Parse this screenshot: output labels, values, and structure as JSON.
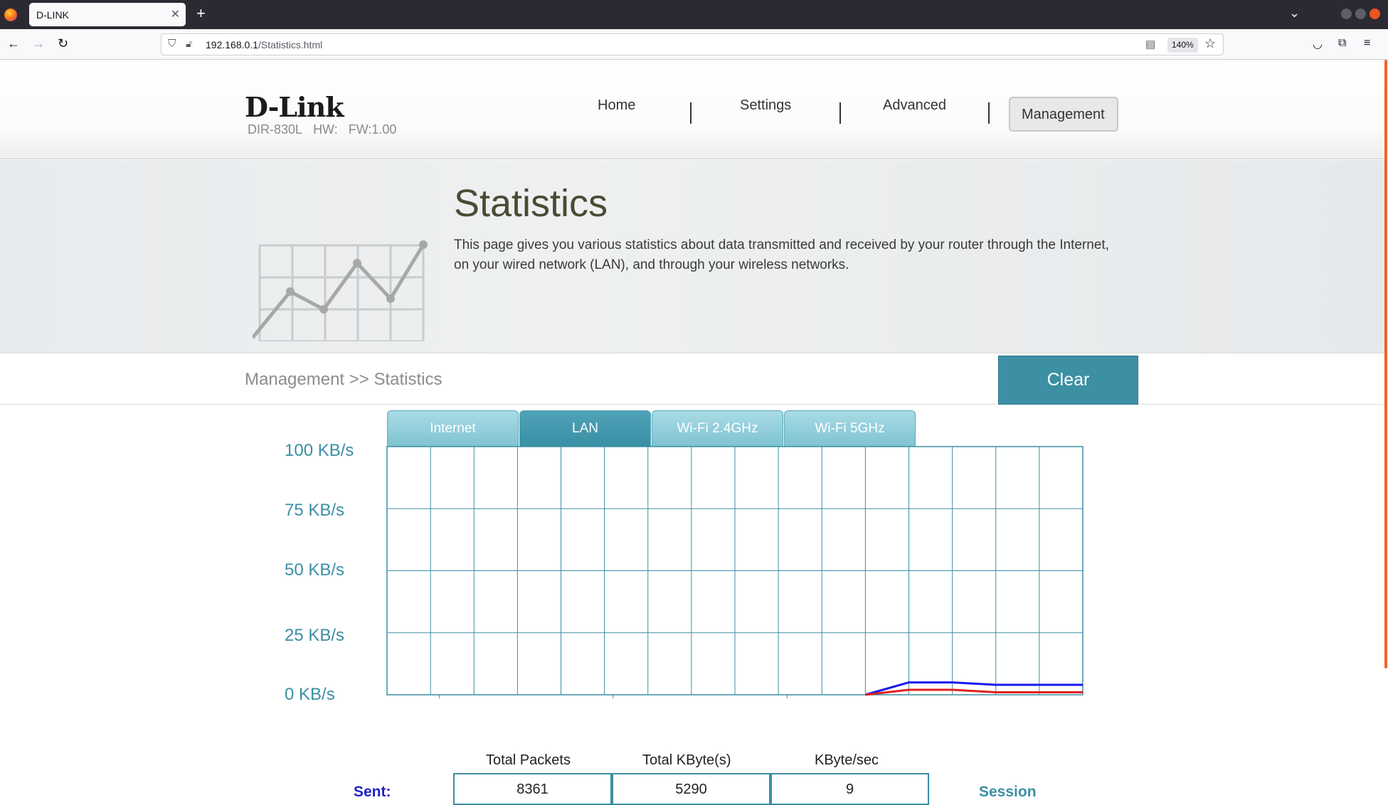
{
  "browser": {
    "tab_title": "D-LINK",
    "url_host": "192.168.0.1",
    "url_path": "/Statistics.html",
    "zoom": "140%"
  },
  "header": {
    "logo": "D-Link",
    "model": "DIR-830L",
    "hw_label": "HW:",
    "fw_label": "FW:1.00",
    "menu": {
      "home": "Home",
      "settings": "Settings",
      "advanced": "Advanced",
      "management": "Management"
    }
  },
  "banner": {
    "title": "Statistics",
    "description": "This page gives you various statistics about data transmitted and received by your router through the Internet, on your wired network (LAN), and through your wireless networks."
  },
  "breadcrumb": "Management >> Statistics",
  "clear_label": "Clear",
  "tabs": [
    "Internet",
    "LAN",
    "Wi-Fi 2.4GHz",
    "Wi-Fi 5GHz"
  ],
  "active_tab": "LAN",
  "chart_data": {
    "type": "line",
    "yticks": [
      "100 KB/s",
      "75 KB/s",
      "50 KB/s",
      "25 KB/s",
      "0 KB/s"
    ],
    "ylim": [
      0,
      100
    ],
    "series": [
      {
        "color": "#1a1aee",
        "x": [
          12,
          13,
          14,
          15,
          16
        ],
        "values": [
          0,
          5,
          5,
          4,
          4
        ]
      },
      {
        "color": "#e02020",
        "x": [
          12,
          13,
          14,
          15,
          16
        ],
        "values": [
          0,
          2,
          2,
          1,
          1
        ]
      }
    ],
    "x_count": 16,
    "grid": true
  },
  "stats": {
    "headers": [
      "Total Packets",
      "Total KByte(s)",
      "KByte/sec"
    ],
    "sent_label": "Sent:",
    "sent": [
      "8361",
      "5290",
      "9"
    ],
    "session_label": "Session"
  },
  "colors": {
    "accent": "#3a8fa4",
    "tab_light": "#8ccad7",
    "sent_blue": "#1f1fcc"
  }
}
